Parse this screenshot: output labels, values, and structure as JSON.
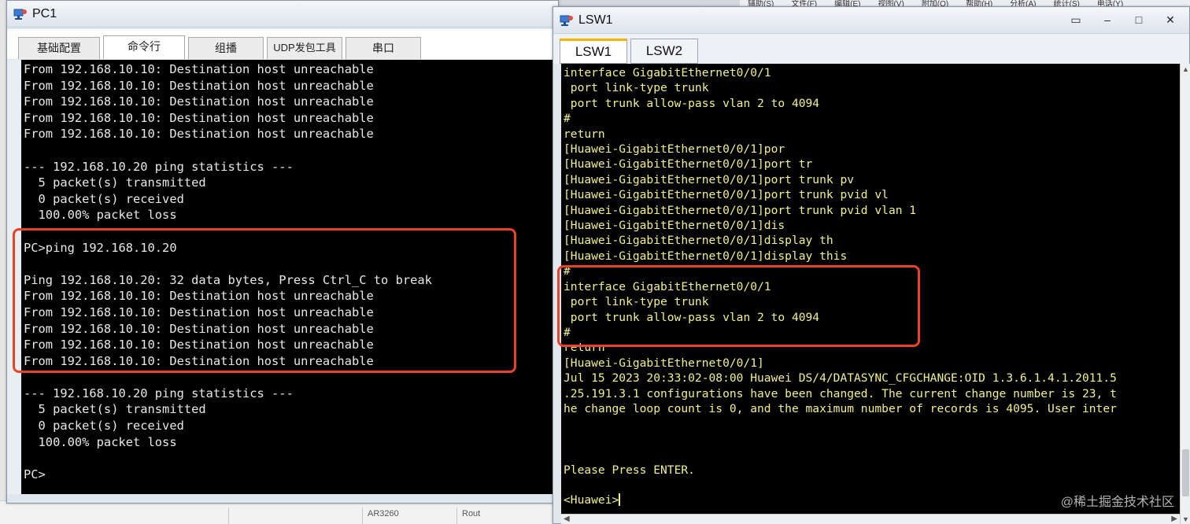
{
  "background": {
    "menu_items": [
      "辅助(S)",
      "文件(F)",
      "编辑(E)",
      "视图(V)",
      "附加(Q)",
      "帮助(H)",
      "分析(A)",
      "统计(S)",
      "电话(Y)"
    ],
    "bottom_cells": [
      "AR3260",
      "Rout"
    ]
  },
  "pc1": {
    "title": "PC1",
    "tabs": [
      "基础配置",
      "命令行",
      "组播",
      "UDP发包工具",
      "串口"
    ],
    "active_tab": 1,
    "console_lines": [
      "From 192.168.10.10: Destination host unreachable",
      "From 192.168.10.10: Destination host unreachable",
      "From 192.168.10.10: Destination host unreachable",
      "From 192.168.10.10: Destination host unreachable",
      "From 192.168.10.10: Destination host unreachable",
      "",
      "--- 192.168.10.20 ping statistics ---",
      "  5 packet(s) transmitted",
      "  0 packet(s) received",
      "  100.00% packet loss",
      "",
      "PC>ping 192.168.10.20",
      "",
      "Ping 192.168.10.20: 32 data bytes, Press Ctrl_C to break",
      "From 192.168.10.10: Destination host unreachable",
      "From 192.168.10.10: Destination host unreachable",
      "From 192.168.10.10: Destination host unreachable",
      "From 192.168.10.10: Destination host unreachable",
      "From 192.168.10.10: Destination host unreachable",
      "",
      "--- 192.168.10.20 ping statistics ---",
      "  5 packet(s) transmitted",
      "  0 packet(s) received",
      "  100.00% packet loss",
      "",
      "PC>"
    ]
  },
  "lsw1": {
    "title": "LSW1",
    "tabs": [
      "LSW1",
      "LSW2"
    ],
    "active_tab": 0,
    "console_lines": [
      "interface GigabitEthernet0/0/1",
      " port link-type trunk",
      " port trunk allow-pass vlan 2 to 4094",
      "#",
      "return",
      "[Huawei-GigabitEthernet0/0/1]por",
      "[Huawei-GigabitEthernet0/0/1]port tr",
      "[Huawei-GigabitEthernet0/0/1]port trunk pv",
      "[Huawei-GigabitEthernet0/0/1]port trunk pvid vl",
      "[Huawei-GigabitEthernet0/0/1]port trunk pvid vlan 1",
      "[Huawei-GigabitEthernet0/0/1]dis",
      "[Huawei-GigabitEthernet0/0/1]display th",
      "[Huawei-GigabitEthernet0/0/1]display this",
      "#",
      "interface GigabitEthernet0/0/1",
      " port link-type trunk",
      " port trunk allow-pass vlan 2 to 4094",
      "#",
      "return",
      "[Huawei-GigabitEthernet0/0/1]",
      "Jul 15 2023 20:33:02-08:00 Huawei DS/4/DATASYNC_CFGCHANGE:OID 1.3.6.1.4.1.2011.5",
      ".25.191.3.1 configurations have been changed. The current change number is 23, t",
      "he change loop count is 0, and the maximum number of records is 4095. User inter",
      "",
      "",
      "",
      "Please Press ENTER.",
      "",
      "<Huawei>"
    ]
  },
  "watermark": "@稀土掘金技术社区",
  "colors": {
    "highlight": "#e8432a",
    "switch_text": "#f3f08a",
    "pc_text": "#e8e8e8"
  }
}
